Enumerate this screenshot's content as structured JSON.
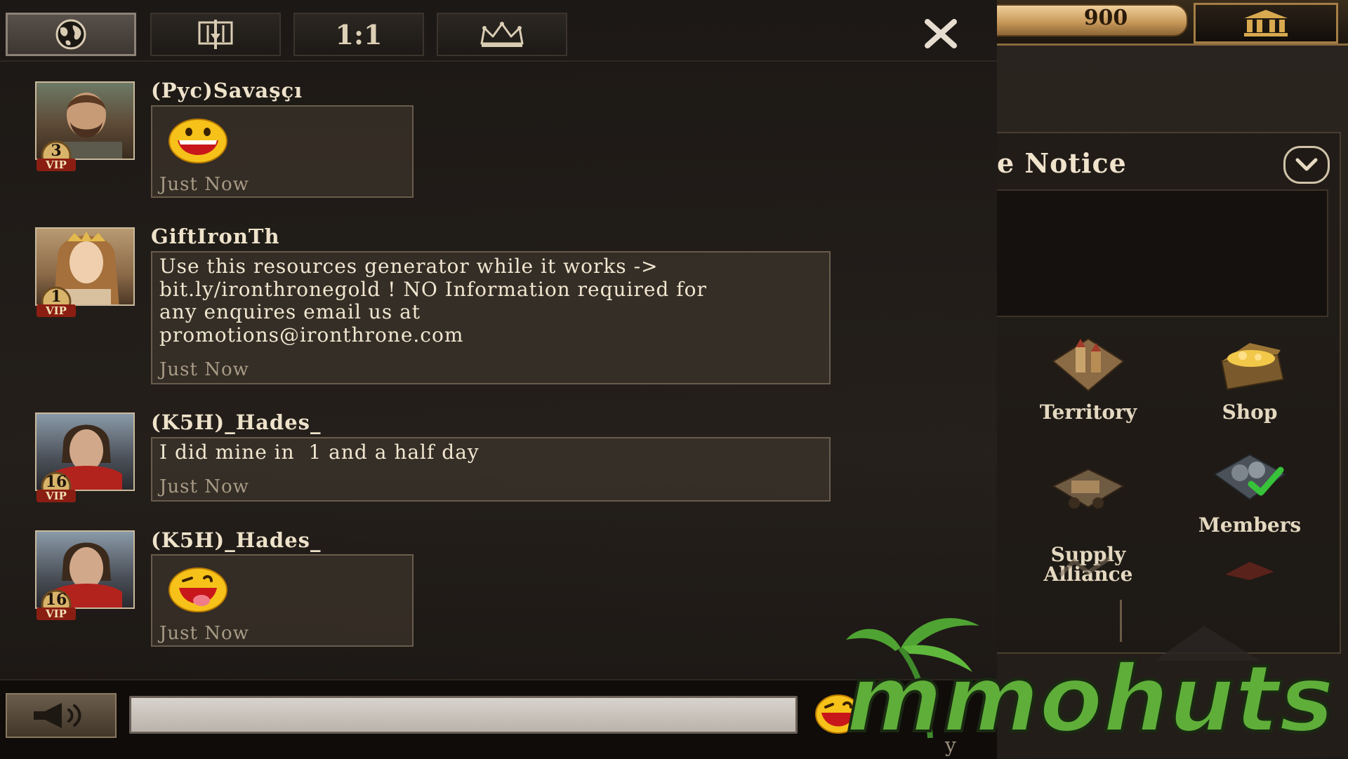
{
  "chat": {
    "tabs": [
      {
        "name": "world",
        "label": "",
        "icon": "globe-icon",
        "active": true
      },
      {
        "name": "alliance",
        "label": "",
        "icon": "alliance-banner-icon",
        "active": false
      },
      {
        "name": "private",
        "label": "1:1",
        "icon": "",
        "active": false
      },
      {
        "name": "kingdom",
        "label": "",
        "icon": "crown-icon",
        "active": false
      }
    ],
    "close_icon": "close-icon",
    "messages": [
      {
        "sender": "(Pyc)Savaşçı",
        "vip": "3",
        "vip_label": "VIP",
        "type": "emoji",
        "emoji": "grin-emoji",
        "text": "",
        "time": "Just Now"
      },
      {
        "sender": "GiftIronTh",
        "vip": "1",
        "vip_label": "VIP",
        "type": "text",
        "emoji": "",
        "text": "Use this resources generator while it works ->\nbit.ly/ironthronegold ! NO Information required for\nany enquires email us at\npromotions@ironthrone.com",
        "time": "Just Now"
      },
      {
        "sender": "(K5H)_Hades_",
        "vip": "16",
        "vip_label": "VIP",
        "type": "text",
        "emoji": "",
        "text": "I did mine in  1 and a half day",
        "time": "Just Now"
      },
      {
        "sender": "(K5H)_Hades_",
        "vip": "16",
        "vip_label": "VIP",
        "type": "emoji",
        "emoji": "wink-tongue-emoji",
        "text": "",
        "time": "Just Now"
      }
    ],
    "input": {
      "value": "",
      "placeholder": ""
    },
    "horn_icon": "megaphone-icon",
    "emoji_icon": "emoji-picker-icon"
  },
  "alliance_panel": {
    "resource_value": "900",
    "bank_icon": "bank-icon",
    "notice_title": "e Notice",
    "notice_body": "",
    "menu": [
      {
        "label": "Territory",
        "icon": "territory-icon"
      },
      {
        "label": "Shop",
        "icon": "treasure-chest-icon"
      },
      {
        "label": "Supply\nAlliance",
        "icon": "supply-cart-icon"
      },
      {
        "label": "Members",
        "icon": "members-icon"
      }
    ]
  },
  "watermark": {
    "text": "mmohuts"
  },
  "stray_text": "y",
  "colors": {
    "accent_gold": "#c99a5b",
    "panel_dark": "#1c1916",
    "vip_red": "#8b1e12",
    "watermark_green": "#5fae3a"
  }
}
